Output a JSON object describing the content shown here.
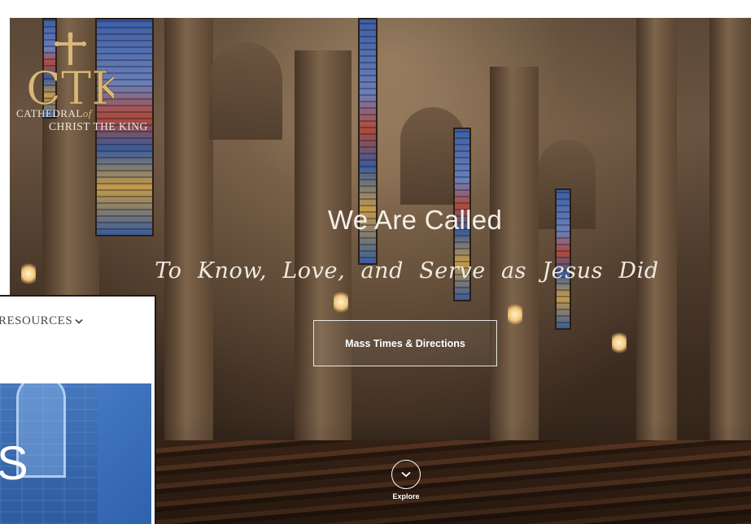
{
  "logo": {
    "monogram": "CTK",
    "line1_a": "CATHEDRAL",
    "line1_b": "of",
    "line2": "CHRIST THE KING",
    "icon": "cross-icon"
  },
  "hero": {
    "headline": "We Are Called",
    "tagline": "To Know, Love, and Serve as Jesus Did",
    "cta_label": "Mass Times & Directions",
    "explore_label": "Explore",
    "explore_icon": "chevron-down-icon"
  },
  "inset": {
    "nav_label": "RESOURCES",
    "nav_icon": "chevron-down-icon",
    "image_text": "S"
  },
  "colors": {
    "text_light": "#f4efe8",
    "logo_gold": "#d8b77a",
    "inset_blue": "#3f74bf"
  }
}
